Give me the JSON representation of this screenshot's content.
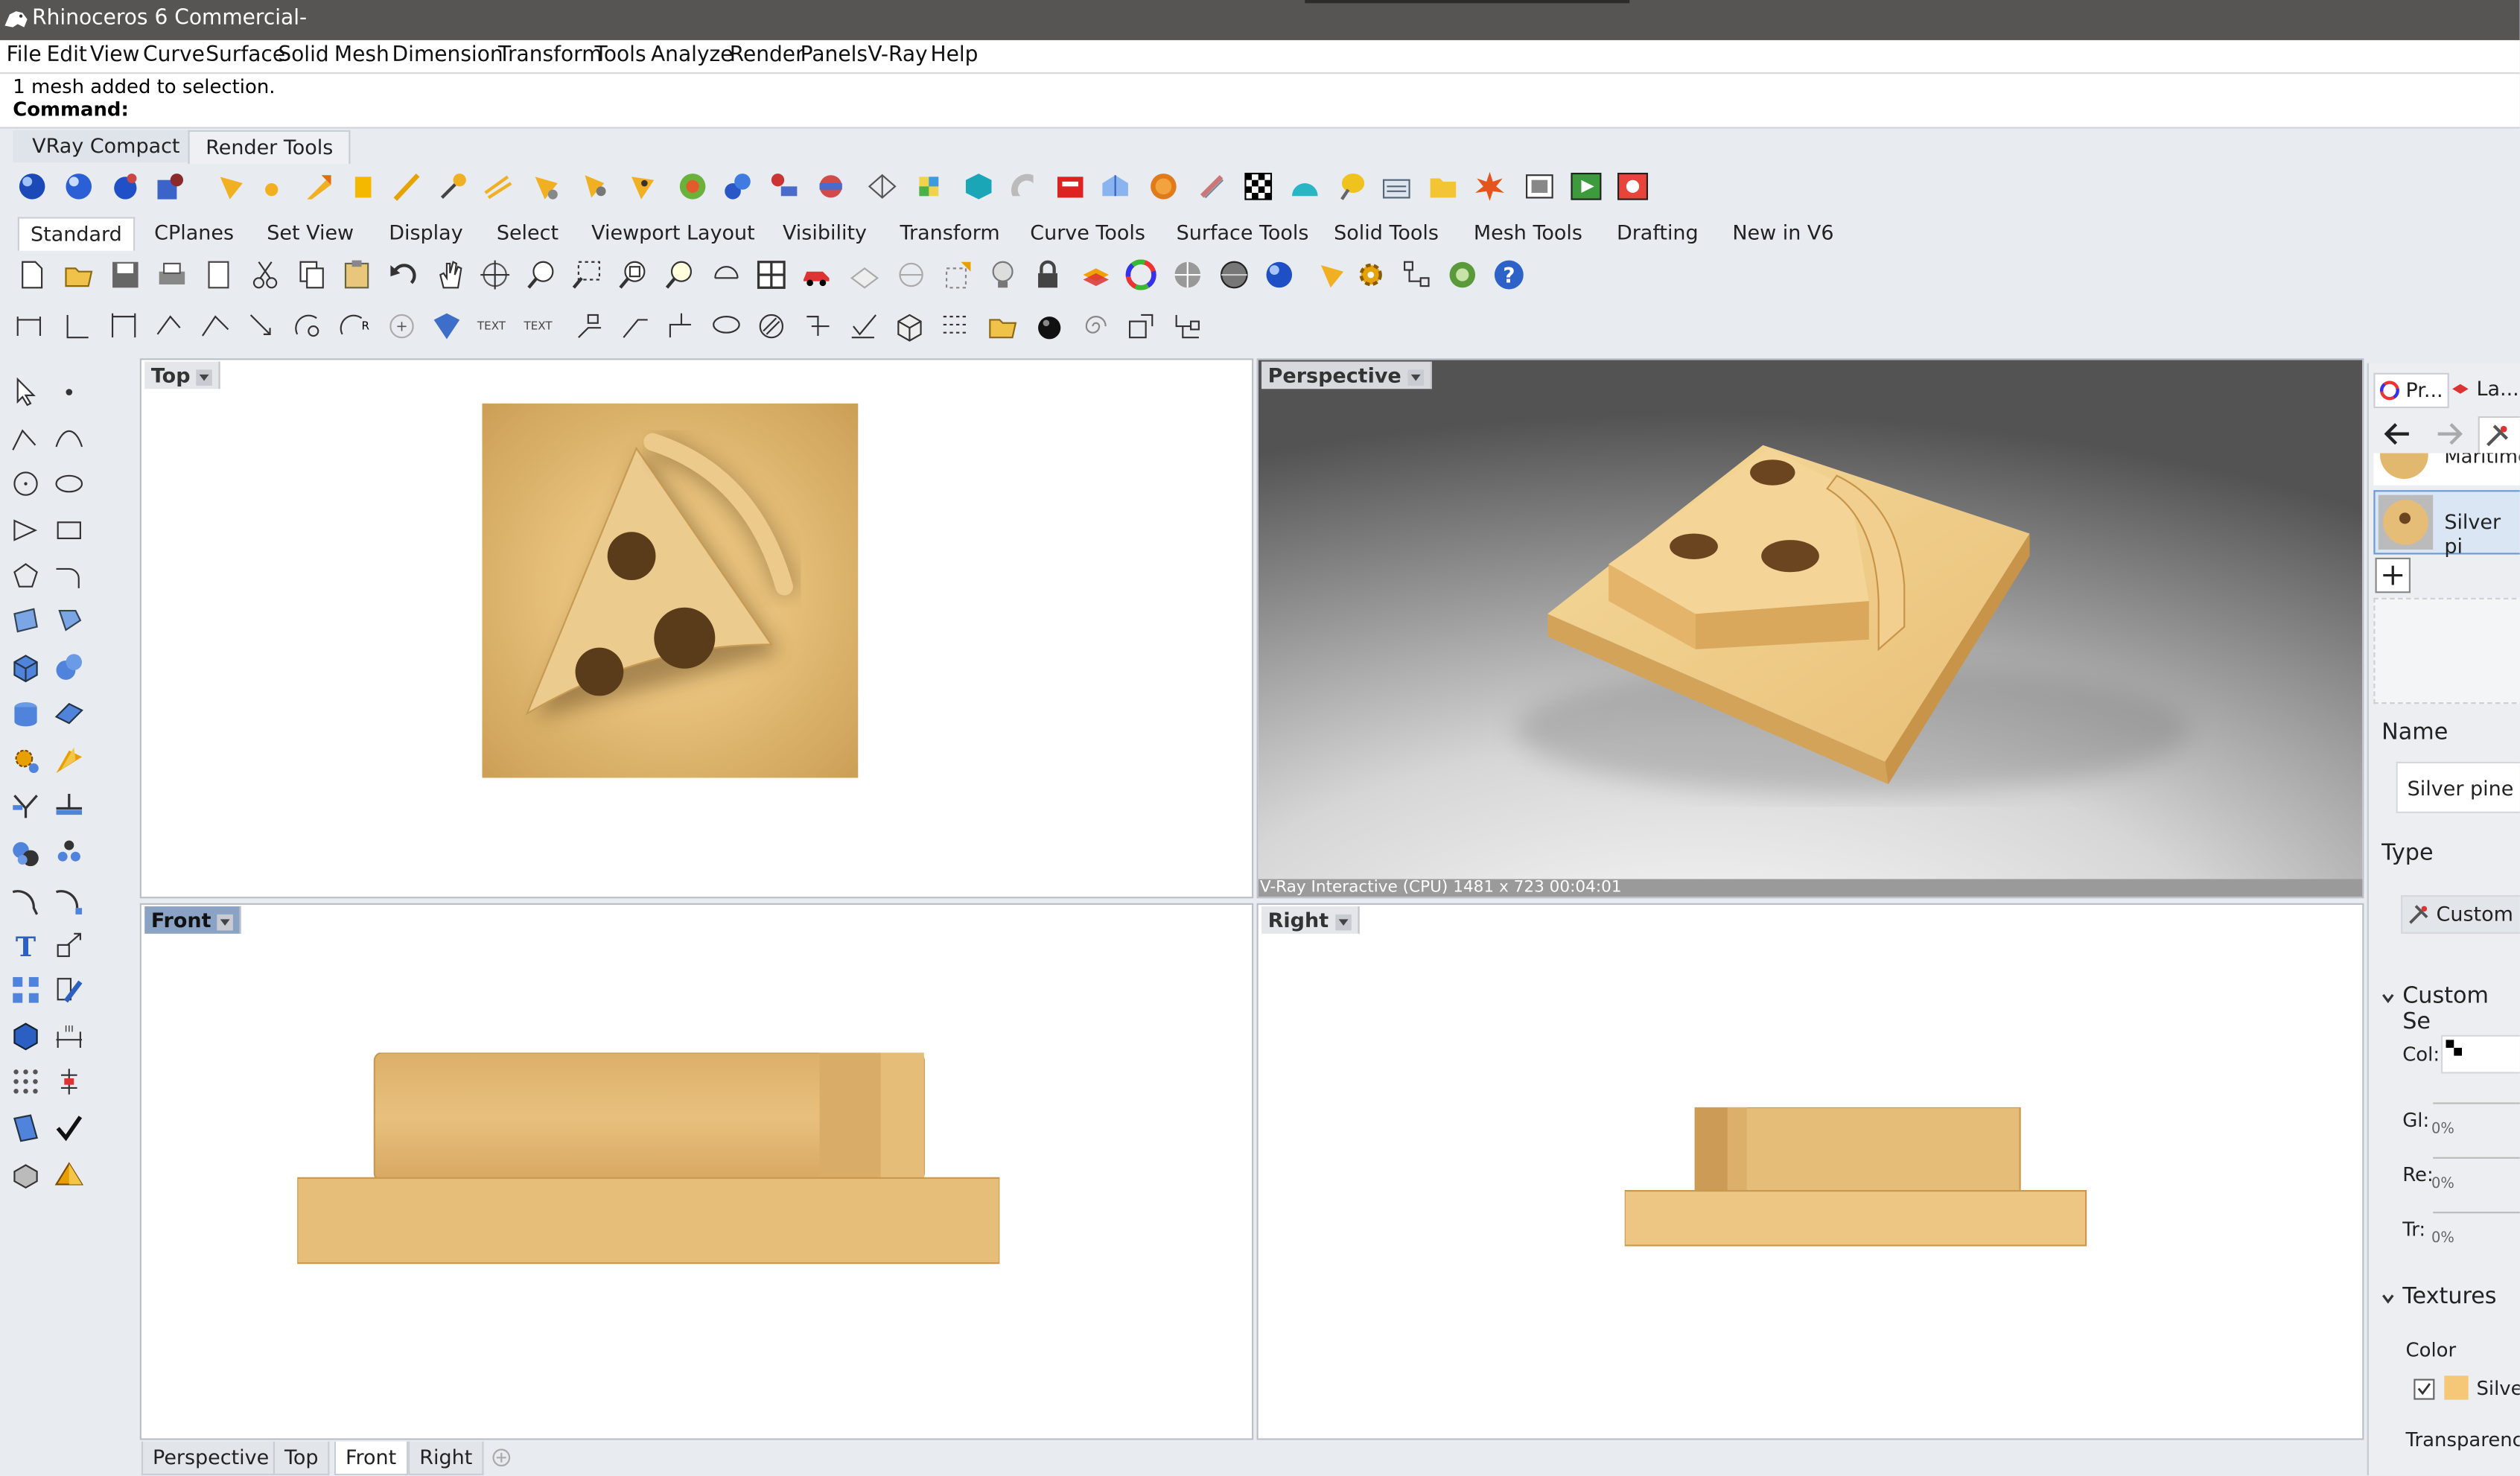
{
  "window": {
    "title": "Rhinoceros 6 Commercial-"
  },
  "menu": [
    "File",
    "Edit",
    "View",
    "Curve",
    "Surface",
    "Solid",
    "Mesh",
    "Dimension",
    "Transform",
    "Tools",
    "Analyze",
    "Render",
    "Panels",
    "V-Ray",
    "Help"
  ],
  "command": {
    "history": "1 mesh added to selection.",
    "prompt": "Command:"
  },
  "render_tabs": [
    "VRay Compact",
    "Render Tools"
  ],
  "toolbar_tabs": [
    "Standard",
    "CPlanes",
    "Set View",
    "Display",
    "Select",
    "Viewport Layout",
    "Visibility",
    "Transform",
    "Curve Tools",
    "Surface Tools",
    "Solid Tools",
    "Mesh Tools",
    "Drafting",
    "New in V6"
  ],
  "icon_text": {
    "text1": "TEXT",
    "text2": "TEXT"
  },
  "viewports": {
    "top": "Top",
    "perspective": "Perspective",
    "front": "Front",
    "right": "Right",
    "perspective_status": "V-Ray Interactive (CPU)   1481 x 723   00:04:01"
  },
  "bottom_tabs": [
    "Perspective",
    "Top",
    "Front",
    "Right"
  ],
  "panel": {
    "tab1": "Pr...",
    "tab2": "La...",
    "mat_top": "Maritime",
    "mat_selected": "Silver pi",
    "name_label": "Name",
    "name_value": "Silver pine",
    "type_label": "Type",
    "type_value": "Custom",
    "custom_settings": "Custom Se",
    "col_label": "Col:",
    "gl_label": "Gl:",
    "gl_val": "0%",
    "re_label": "Re:",
    "re_val": "0%",
    "tr_label": "Tr:",
    "tr_val": "0%",
    "textures": "Textures",
    "color_label": "Color",
    "color_tex": "Silver",
    "transparency": "Transparency"
  },
  "colors": {
    "titlebar": "#575554",
    "wood": "#e6bf7c",
    "selected_tab": "#8aa3c4"
  }
}
